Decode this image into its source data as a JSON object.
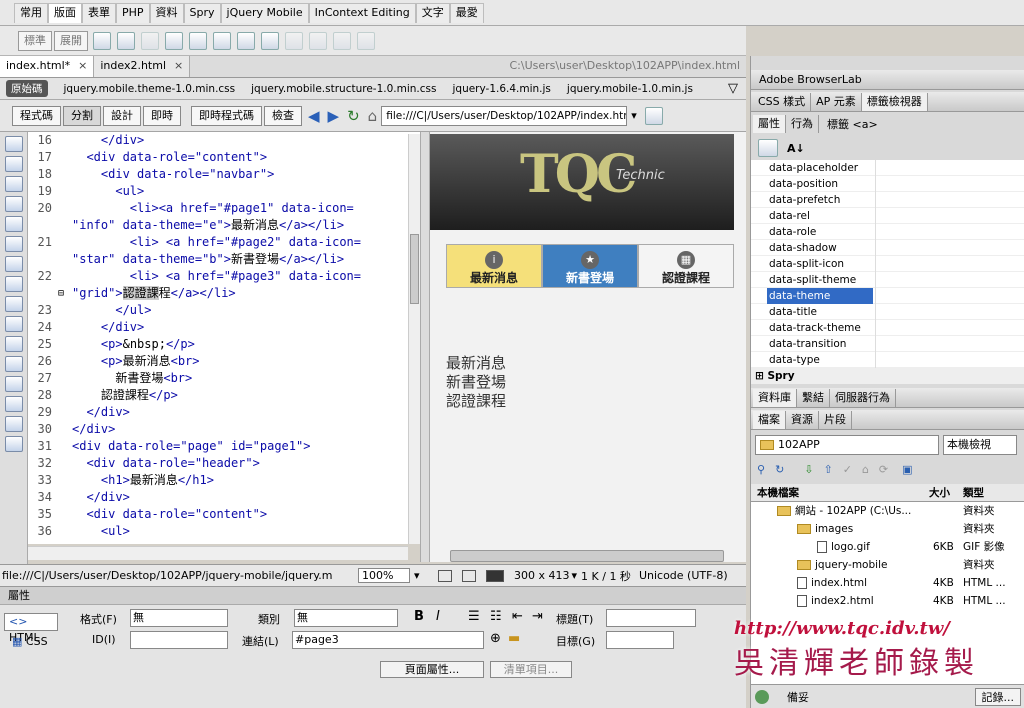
{
  "insert_tabs": [
    "常用",
    "版面",
    "表單",
    "PHP",
    "資料",
    "Spry",
    "jQuery Mobile",
    "InContext Editing",
    "文字",
    "最愛"
  ],
  "insert_active": 1,
  "insert_buttons": {
    "standard": "標準",
    "expanded": "展開"
  },
  "doc_tabs": [
    {
      "label": "index.html*",
      "active": true
    },
    {
      "label": "index2.html",
      "active": false
    }
  ],
  "doc_path": "C:\\Users\\user\\Desktop\\102APP\\index.html",
  "related_files": [
    "原始碼",
    "jquery.mobile.theme-1.0.min.css",
    "jquery.mobile.structure-1.0.min.css",
    "jquery-1.6.4.min.js",
    "jquery.mobile-1.0.min.js"
  ],
  "view_buttons": [
    "程式碼",
    "分割",
    "設計",
    "即時"
  ],
  "view_buttons2": [
    "即時程式碼",
    "檢查"
  ],
  "address": "file:///C|/Users/user/Desktop/102APP/index.html",
  "code_lines": [
    {
      "n": "16",
      "html": "    <span class='tag'>&lt;/div&gt;</span>"
    },
    {
      "n": "17",
      "html": "  <span class='tag'>&lt;div data-role=</span><span class='val'>\"content\"</span><span class='tag'>&gt;</span>"
    },
    {
      "n": "18",
      "html": "    <span class='tag'>&lt;div data-role=</span><span class='val'>\"navbar\"</span><span class='tag'>&gt;</span>"
    },
    {
      "n": "19",
      "html": "      <span class='tag'>&lt;ul&gt;</span>"
    },
    {
      "n": "20",
      "html": "        <span class='tag'>&lt;li&gt;&lt;a href=</span><span class='val'>\"#page1\"</span> <span class='tag'>data-icon=</span>"
    },
    {
      "n": "",
      "html": "<span class='val'>\"info\"</span> <span class='tag'>data-theme=</span><span class='val'>\"e\"</span><span class='tag'>&gt;</span>最新消息<span class='tag'>&lt;/a&gt;&lt;/li&gt;</span>"
    },
    {
      "n": "21",
      "html": "        <span class='tag'>&lt;li&gt; &lt;a href=</span><span class='val'>\"#page2\"</span> <span class='tag'>data-icon=</span>"
    },
    {
      "n": "",
      "html": "<span class='val'>\"star\"</span> <span class='tag'>data-theme=</span><span class='val'>\"b\"</span><span class='tag'>&gt;</span>新書登場<span class='tag'>&lt;/a&gt;&lt;/li&gt;</span>"
    },
    {
      "n": "22",
      "html": "        <span class='tag'>&lt;li&gt; &lt;a href=</span><span class='val'>\"#page3\"</span> <span class='tag'>data-icon=</span>"
    },
    {
      "n": "",
      "html": "<span class='val'>\"grid\"</span><span class='tag'>&gt;</span><span style='background:#ccc'>認證課</span>程<span class='tag'>&lt;/a&gt;&lt;/li&gt;</span>"
    },
    {
      "n": "23",
      "html": "      <span class='tag'>&lt;/ul&gt;</span>"
    },
    {
      "n": "24",
      "html": "    <span class='tag'>&lt;/div&gt;</span>"
    },
    {
      "n": "25",
      "html": "    <span class='tag'>&lt;p&gt;</span>&amp;nbsp;<span class='tag'>&lt;/p&gt;</span>"
    },
    {
      "n": "26",
      "html": "    <span class='tag'>&lt;p&gt;</span>最新消息<span class='tag'>&lt;br&gt;</span>"
    },
    {
      "n": "27",
      "html": "      新書登場<span class='tag'>&lt;br&gt;</span>"
    },
    {
      "n": "28",
      "html": "    認證課程<span class='tag'>&lt;/p&gt;</span>"
    },
    {
      "n": "29",
      "html": "  <span class='tag'>&lt;/div&gt;</span>"
    },
    {
      "n": "30",
      "html": "<span class='tag'>&lt;/div&gt;</span>"
    },
    {
      "n": "31",
      "html": "<span class='tag'>&lt;div data-role=</span><span class='val'>\"page\"</span> <span class='tag'>id=</span><span class='val'>\"page1\"</span><span class='tag'>&gt;</span>"
    },
    {
      "n": "32",
      "html": "  <span class='tag'>&lt;div data-role=</span><span class='val'>\"header\"</span><span class='tag'>&gt;</span>"
    },
    {
      "n": "33",
      "html": "    <span class='tag'>&lt;h1&gt;</span>最新消息<span class='tag'>&lt;/h1&gt;</span>"
    },
    {
      "n": "34",
      "html": "  <span class='tag'>&lt;/div&gt;</span>"
    },
    {
      "n": "35",
      "html": "  <span class='tag'>&lt;div data-role=</span><span class='val'>\"content\"</span><span class='tag'>&gt;</span>"
    },
    {
      "n": "36",
      "html": "    <span class='tag'>&lt;ul&gt;</span>"
    }
  ],
  "design": {
    "logo": "TQC",
    "logo_sub": "Technic",
    "nav": [
      {
        "label": "最新消息",
        "icon": "i",
        "bg": "#f5e07a",
        "color": "#222"
      },
      {
        "label": "新書登場",
        "icon": "★",
        "bg": "#3f7fc0",
        "color": "#fff"
      },
      {
        "label": "認證課程",
        "icon": "▦",
        "bg": "#f4f4f4",
        "color": "#222"
      }
    ],
    "content": [
      "最新消息",
      "新書登場",
      "認證課程"
    ]
  },
  "status": {
    "path": "file:///C|/Users/user/Desktop/102APP/jquery-mobile/jquery.m",
    "zoom": "100%",
    "size": "300 x 413",
    "file": "1 K / 1 秒",
    "encoding": "Unicode (UTF-8)"
  },
  "props": {
    "title": "屬性",
    "html": "HTML",
    "css": "CSS",
    "format_label": "格式(F)",
    "format_value": "無",
    "class_label": "類別",
    "class_value": "無",
    "id_label": "ID(I)",
    "id_value": "",
    "link_label": "連結(L)",
    "link_value": "#page3",
    "title_label": "標題(T)",
    "title_value": "",
    "target_label": "目標(G)",
    "target_value": "",
    "page_props": "頁面屬性...",
    "list_item": "清單項目..."
  },
  "right": {
    "browserlab": "Adobe BrowserLab",
    "tabs1": [
      "CSS 樣式",
      "AP 元素",
      "標籤檢視器"
    ],
    "attr_tabs": [
      "屬性",
      "行為"
    ],
    "tag_label": "標籤 <a>",
    "attributes": [
      "data-placeholder",
      "data-position",
      "data-prefetch",
      "data-rel",
      "data-role",
      "data-shadow",
      "data-split-icon",
      "data-split-theme",
      "data-theme",
      "data-title",
      "data-track-theme",
      "data-transition",
      "data-type"
    ],
    "selected_attr": "data-theme",
    "spry": "Spry",
    "tabs2": [
      "資料庫",
      "繫結",
      "伺服器行為"
    ],
    "tabs3": [
      "檔案",
      "資源",
      "片段"
    ],
    "site": "102APP",
    "view": "本機檢視",
    "file_headers": [
      "本機檔案",
      "大小",
      "類型"
    ],
    "files": [
      {
        "name": "網站 - 102APP (C:\\Us...",
        "size": "",
        "type": "資料夾",
        "indent": 1,
        "kind": "folder"
      },
      {
        "name": "images",
        "size": "",
        "type": "資料夾",
        "indent": 2,
        "kind": "folder"
      },
      {
        "name": "logo.gif",
        "size": "6KB",
        "type": "GIF 影像",
        "indent": 3,
        "kind": "file"
      },
      {
        "name": "jquery-mobile",
        "size": "",
        "type": "資料夾",
        "indent": 2,
        "kind": "folder"
      },
      {
        "name": "index.html",
        "size": "4KB",
        "type": "HTML ...",
        "indent": 2,
        "kind": "file"
      },
      {
        "name": "index2.html",
        "size": "4KB",
        "type": "HTML ...",
        "indent": 2,
        "kind": "file"
      }
    ],
    "ready": "備妥",
    "log": "記錄..."
  },
  "watermark1": "http://www.tqc.idv.tw/",
  "watermark2": "吳清輝老師錄製"
}
